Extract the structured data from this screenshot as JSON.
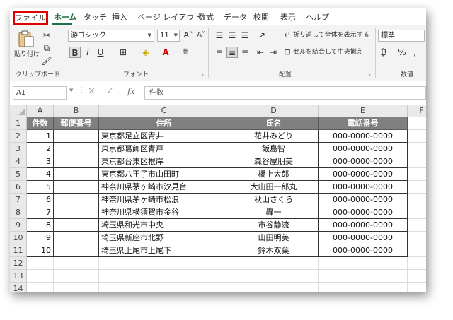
{
  "tabs": {
    "file": "ファイル",
    "home": "ホーム",
    "touch": "タッチ",
    "insert": "挿入",
    "page_layout": "ページ レイアウト",
    "formulas": "数式",
    "data": "データ",
    "review": "校閲",
    "view": "表示",
    "help": "ヘルプ"
  },
  "ribbon": {
    "clipboard": {
      "paste": "貼り付け",
      "label": "クリップボード"
    },
    "font": {
      "name": "游ゴシック",
      "size": "11",
      "bold": "B",
      "italic": "I",
      "underline": "U",
      "label": "フォント"
    },
    "alignment": {
      "wrap_text": "折り返して全体を表示する",
      "merge_center": "セルを結合して中央揃え",
      "label": "配置"
    },
    "number": {
      "format": "標準",
      "label": "数値"
    }
  },
  "formula_bar": {
    "name_box": "A1",
    "fx": "fx",
    "value": "件数"
  },
  "sheet": {
    "columns": [
      "A",
      "B",
      "C",
      "D",
      "E",
      "F"
    ],
    "row_numbers": [
      "1",
      "2",
      "3",
      "4",
      "5",
      "6",
      "7",
      "8",
      "9",
      "10",
      "11",
      "12",
      "13",
      "14"
    ],
    "headers": [
      "件数",
      "郵便番号",
      "住所",
      "氏名",
      "電話番号"
    ],
    "rows": [
      [
        "1",
        "",
        "東京都足立区青井",
        "花井みどり",
        "000-0000-0000"
      ],
      [
        "2",
        "",
        "東京都葛飾区青戸",
        "飯島智",
        "000-0000-0000"
      ],
      [
        "3",
        "",
        "東京都台東区根岸",
        "森谷屋朋美",
        "000-0000-0000"
      ],
      [
        "4",
        "",
        "東京都八王子市山田町",
        "橋上太郎",
        "000-0000-0000"
      ],
      [
        "5",
        "",
        "神奈川県茅ヶ崎市汐見台",
        "大山田一郎丸",
        "000-0000-0000"
      ],
      [
        "6",
        "",
        "神奈川県茅ヶ崎市松浪",
        "秋山さくら",
        "000-0000-0000"
      ],
      [
        "7",
        "",
        "神奈川県横須賀市金谷",
        "轟一",
        "000-0000-0000"
      ],
      [
        "8",
        "",
        "埼玉県和光市中央",
        "市谷静流",
        "000-0000-0000"
      ],
      [
        "9",
        "",
        "埼玉県新座市北野",
        "山田明美",
        "000-0000-0000"
      ],
      [
        "10",
        "",
        "埼玉県上尾市上尾下",
        "鈴木双葉",
        "000-0000-0000"
      ]
    ]
  },
  "colors": {
    "header_fill": "#808080",
    "file_highlight": "#e00000",
    "accent": "#1e7145"
  }
}
